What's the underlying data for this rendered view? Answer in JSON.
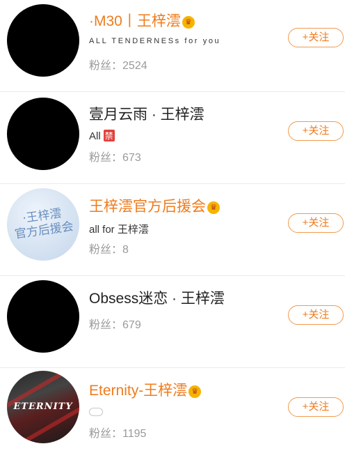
{
  "users": [
    {
      "name": "·M30丨王梓澐",
      "verified": true,
      "bio": "ALL TENDERNESs for you",
      "fans_label": "粉丝：",
      "fans_count": "2524",
      "follow_label": "+关注"
    },
    {
      "name": "壹月云雨 · 王梓澐",
      "verified": false,
      "bio": "All",
      "bio_badge": "禁",
      "fans_label": "粉丝：",
      "fans_count": "673",
      "follow_label": "+关注"
    },
    {
      "name": "王梓澐官方后援会",
      "verified": true,
      "avatar_text": "·王梓澐\n官方后援会",
      "bio": "all for 王梓澐",
      "fans_label": "粉丝：",
      "fans_count": "8",
      "follow_label": "+关注"
    },
    {
      "name": "Obsess迷恋 · 王梓澐",
      "verified": false,
      "fans_label": "粉丝：",
      "fans_count": "679",
      "follow_label": "+关注"
    },
    {
      "name": "Eternity-王梓澐",
      "verified": true,
      "avatar_text": "ETERNITY",
      "bio_icon": "cloud-icon",
      "fans_label": "粉丝：",
      "fans_count": "1195",
      "follow_label": "+关注"
    }
  ],
  "colors": {
    "accent_orange": "#f07b1c",
    "follow_border": "#f39a4b",
    "fans_gray": "#9a9a9a",
    "badge_red": "#e2423a",
    "crown_gold": "#f5b400"
  }
}
